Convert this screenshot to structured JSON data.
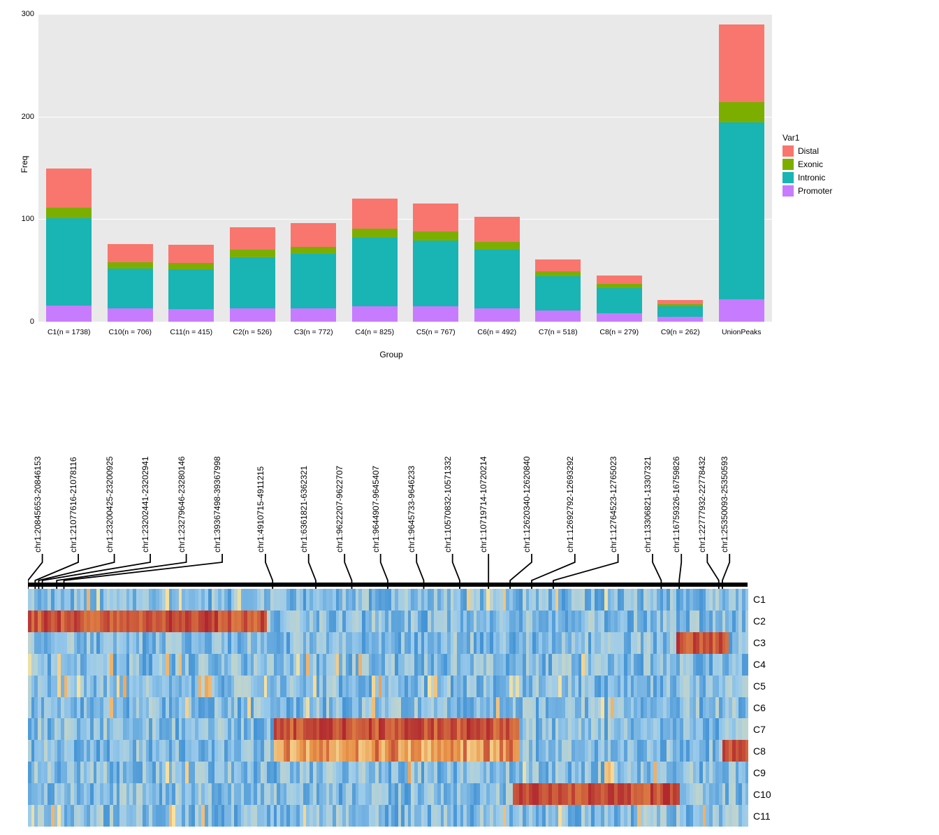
{
  "chart_data": [
    {
      "type": "bar",
      "stacked": true,
      "ylabel": "Freq",
      "xlabel": "Group",
      "ylim": [
        0,
        300
      ],
      "yticks": [
        0,
        100,
        200,
        300
      ],
      "legend_title": "Var1",
      "categories_order": [
        "Promoter",
        "Intronic",
        "Exonic",
        "Distal"
      ],
      "colors": {
        "Distal": "#F8766D",
        "Exonic": "#7CAE00",
        "Intronic": "#19B4B4",
        "Promoter": "#C77CFF"
      },
      "series": [
        {
          "label": "C1(n = 1738)",
          "values": {
            "Promoter": 16,
            "Intronic": 85,
            "Exonic": 10,
            "Distal": 38
          }
        },
        {
          "label": "C10(n = 706)",
          "values": {
            "Promoter": 13,
            "Intronic": 39,
            "Exonic": 6,
            "Distal": 18
          }
        },
        {
          "label": "C11(n = 415)",
          "values": {
            "Promoter": 12,
            "Intronic": 39,
            "Exonic": 6,
            "Distal": 18
          }
        },
        {
          "label": "C2(n = 526)",
          "values": {
            "Promoter": 13,
            "Intronic": 50,
            "Exonic": 7,
            "Distal": 22
          }
        },
        {
          "label": "C3(n = 772)",
          "values": {
            "Promoter": 13,
            "Intronic": 53,
            "Exonic": 7,
            "Distal": 23
          }
        },
        {
          "label": "C4(n = 825)",
          "values": {
            "Promoter": 15,
            "Intronic": 67,
            "Exonic": 9,
            "Distal": 29
          }
        },
        {
          "label": "C5(n = 767)",
          "values": {
            "Promoter": 15,
            "Intronic": 64,
            "Exonic": 9,
            "Distal": 27
          }
        },
        {
          "label": "C6(n = 492)",
          "values": {
            "Promoter": 13,
            "Intronic": 57,
            "Exonic": 8,
            "Distal": 24
          }
        },
        {
          "label": "C7(n = 518)",
          "values": {
            "Promoter": 11,
            "Intronic": 33,
            "Exonic": 5,
            "Distal": 12
          }
        },
        {
          "label": "C8(n = 279)",
          "values": {
            "Promoter": 8,
            "Intronic": 25,
            "Exonic": 4,
            "Distal": 8
          }
        },
        {
          "label": "C9(n = 262)",
          "values": {
            "Promoter": 5,
            "Intronic": 10,
            "Exonic": 2,
            "Distal": 4
          }
        },
        {
          "label": "UnionPeaks",
          "values": {
            "Promoter": 22,
            "Intronic": 172,
            "Exonic": 20,
            "Distal": 76
          }
        }
      ]
    },
    {
      "type": "heatmap",
      "row_labels": [
        "C1",
        "C2",
        "C3",
        "C4",
        "C5",
        "C6",
        "C7",
        "C8",
        "C9",
        "C10",
        "C11"
      ],
      "col_labels_shown": [
        "chr1:20845653-20846153",
        "chr1:21077616-21078116",
        "chr1:23200425-23200925",
        "chr1:23202441-23202941",
        "chr1:23279646-23280146",
        "chr1:39367498-39367998",
        "chr1:4910715-4911215",
        "chr1:6361821-6362321",
        "chr1:9622207-9622707",
        "chr1:9644907-9645407",
        "chr1:9645733-9646233",
        "chr1:10570832-10571332",
        "chr1:10719714-10720214",
        "chr1:12620340-12620840",
        "chr1:12692792-12693292",
        "chr1:12764523-12765023",
        "chr1:13306821-13307321",
        "chr1:16759326-16759826",
        "chr1:22777932-22778432",
        "chr1:25350093-25350593"
      ],
      "col_positions_fraction": [
        0.02,
        0.07,
        0.12,
        0.17,
        0.22,
        0.27,
        0.33,
        0.39,
        0.44,
        0.49,
        0.54,
        0.59,
        0.64,
        0.7,
        0.76,
        0.82,
        0.868,
        0.908,
        0.944,
        0.975
      ],
      "anchor_positions_fraction": [
        0.0,
        0.01,
        0.015,
        0.02,
        0.04,
        0.05,
        0.34,
        0.4,
        0.45,
        0.5,
        0.55,
        0.6,
        0.64,
        0.67,
        0.7,
        0.73,
        0.88,
        0.905,
        0.96,
        0.965
      ],
      "note": "Heatmap shows many more genomic regions (columns) than the 20 labeled ones. Blue→red continuous scale. High-value (red) blocks by row: C2≈cols 0–0.33 fraction; C3≈0.90–0.97; C7≈0.34–0.68; C8≈0.34–0.68 (lighter) and 0.96–1.0; C10≈0.67–0.90. Other rows predominantly low (blue) with scattered moderate values.",
      "palette_lowhigh": [
        "#2E86D0",
        "#9BCBEB",
        "#F7E29E",
        "#E89248",
        "#B0272F"
      ]
    }
  ]
}
